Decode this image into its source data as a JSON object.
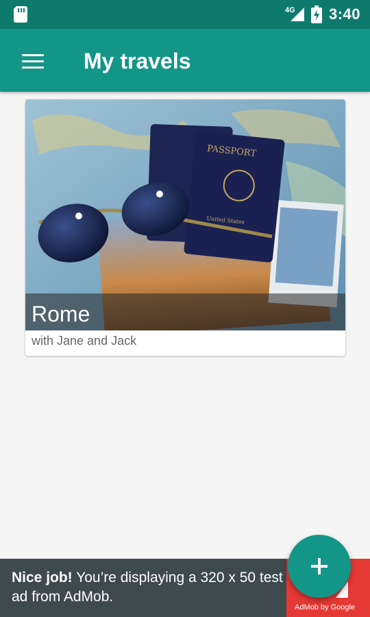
{
  "status_bar": {
    "sd_icon": "sd-card-icon",
    "network_label": "4G",
    "signal_icon": "signal-icon",
    "battery_icon": "battery-charging-icon",
    "time": "3:40"
  },
  "app_bar": {
    "menu_icon": "hamburger-menu-icon",
    "title": "My travels",
    "color": "#139688"
  },
  "travels": [
    {
      "title": "Rome",
      "subtitle": "with Jane and Jack",
      "image": "passports-and-sunglasses-on-map-photo"
    }
  ],
  "ad": {
    "bold": "Nice job!",
    "text": " You’re displaying a 320 x 50 test ad from AdMob.",
    "badge": "AdMob by Google",
    "badge_color": "#e53935"
  },
  "fab": {
    "icon": "plus-icon",
    "label": "+"
  }
}
